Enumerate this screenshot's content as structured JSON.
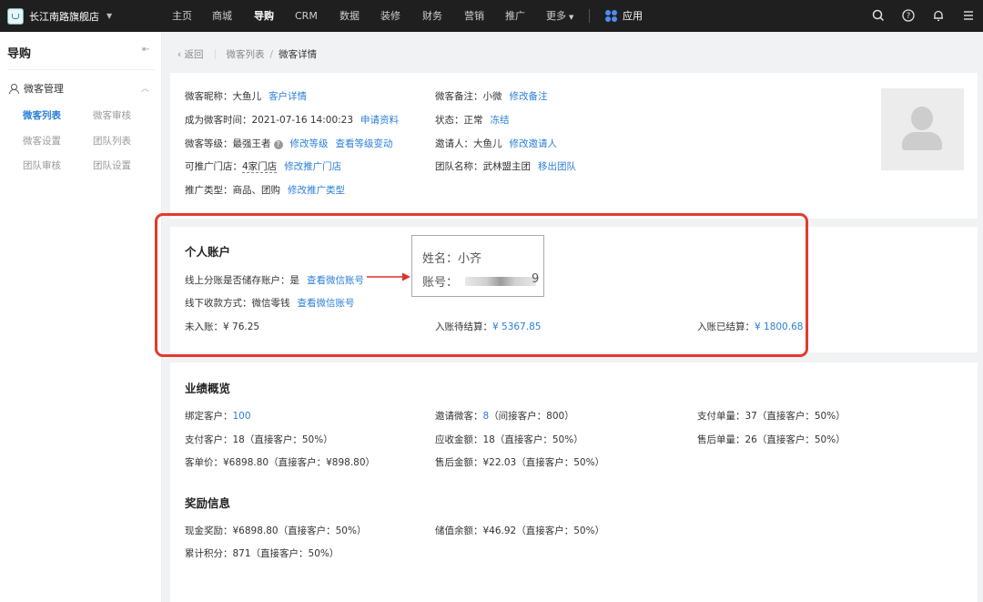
{
  "topbar": {
    "store_name": "长江南路旗舰店",
    "nav": [
      {
        "label": "主页",
        "active": false
      },
      {
        "label": "商城",
        "active": false
      },
      {
        "label": "导购",
        "active": true
      },
      {
        "label": "CRM",
        "active": false
      },
      {
        "label": "数据",
        "active": false
      },
      {
        "label": "装修",
        "active": false
      },
      {
        "label": "财务",
        "active": false
      },
      {
        "label": "营销",
        "active": false
      },
      {
        "label": "推广",
        "active": false
      },
      {
        "label": "更多",
        "active": false
      }
    ],
    "apps_label": "应用",
    "icons": [
      "search-icon",
      "help-icon",
      "bell-icon",
      "menu-icon"
    ]
  },
  "sidebar": {
    "title": "导购",
    "group_label": "微客管理",
    "items": [
      {
        "label": "微客列表",
        "active": true
      },
      {
        "label": "微客审核",
        "active": false
      },
      {
        "label": "微客设置",
        "active": false
      },
      {
        "label": "团队列表",
        "active": false
      },
      {
        "label": "团队审核",
        "active": false
      },
      {
        "label": "团队设置",
        "active": false
      }
    ]
  },
  "breadcrumb": {
    "back": "返回",
    "parent": "微客列表",
    "separator": "/",
    "current": "微客详情"
  },
  "profile": {
    "nickname_label": "微客昵称：",
    "nickname": "大鱼儿",
    "nickname_link": "客户详情",
    "join_time_label": "成为微客时间：",
    "join_time": "2021-07-16 14:00:23",
    "join_time_link": "申请资料",
    "level_label": "微客等级：",
    "level": "最强王者",
    "level_link1": "修改等级",
    "level_link2": "查看等级变动",
    "stores_label": "可推广门店：",
    "stores": "4家门店",
    "stores_link": "修改推广门店",
    "type_label": "推广类型：",
    "type": "商品、团购",
    "type_link": "修改推广类型",
    "remark_label": "微客备注：",
    "remark": "小微",
    "remark_link": "修改备注",
    "status_label": "状态：",
    "status": "正常",
    "status_link": "冻结",
    "inviter_label": "邀请人：",
    "inviter": "大鱼儿",
    "inviter_link": "修改邀请人",
    "team_label": "团队名称：",
    "team": "武林盟主团",
    "team_link": "移出团队"
  },
  "account": {
    "title": "个人账户",
    "online_label": "线上分账是否储存账户：",
    "online_value": "是",
    "online_link": "查看微信账号",
    "offline_label": "线下收款方式：",
    "offline_value": "微信零钱",
    "offline_link": "查看微信账号",
    "unsettled_label": "未入账：",
    "unsettled_value": "¥ 76.25",
    "pending_label": "入账待结算：",
    "pending_value": "¥ 5367.85",
    "settled_label": "入账已结算：",
    "settled_value": "¥ 1800.68"
  },
  "popup": {
    "name_label": "姓名：",
    "name_value": "小齐",
    "account_label": "账号：",
    "account_tail": "9"
  },
  "performance": {
    "title": "业绩概览",
    "bound_label": "绑定客户：",
    "bound_value": "100",
    "invite_label": "邀请微客：",
    "invite_value": "8",
    "invite_extra": "（间接客户：800）",
    "pay_orders": "支付单量：37（直接客户：50%）",
    "pay_customers": "支付客户：18（直接客户：50%）",
    "receivable": "应收金额：18（直接客户：50%）",
    "after_orders": "售后单量：26（直接客户：50%）",
    "avg_price": "客单价：¥6898.80（直接客户：¥898.80）",
    "after_amount": "售后金额：¥22.03（直接客户：50%）"
  },
  "rewards": {
    "title": "奖励信息",
    "cash": "现金奖励：¥6898.80（直接客户：50%）",
    "stored": "储值余额：¥46.92（直接客户：50%）",
    "points": "累计积分：871（直接客户：50%）"
  },
  "colors": {
    "accent": "#2c7fd9",
    "highlight_border": "#e43a2d",
    "topbar_bg": "#1f1f1f"
  }
}
